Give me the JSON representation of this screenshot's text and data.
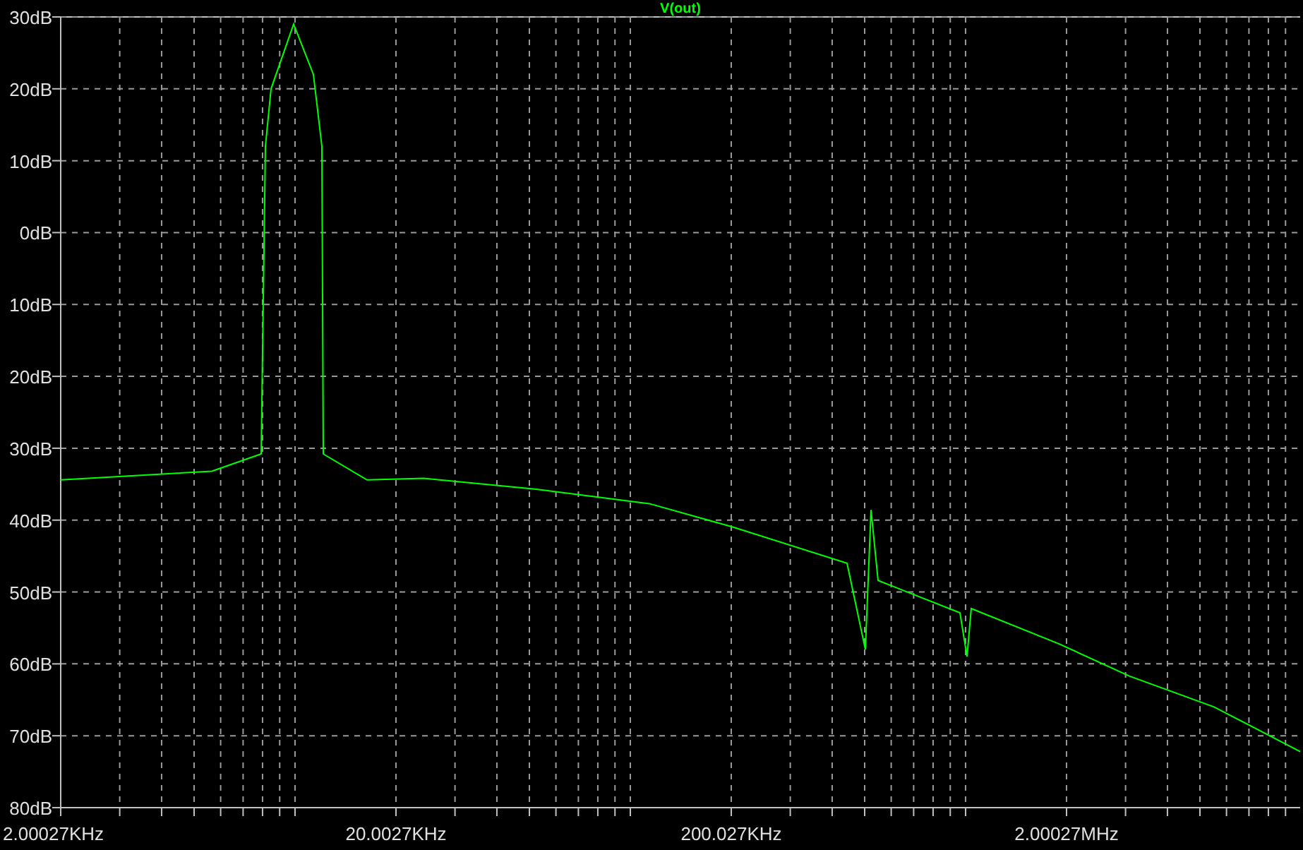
{
  "plot": {
    "title": "V(out)",
    "y_axis_labels": [
      "30dB",
      "20dB",
      "10dB",
      "0dB",
      "10dB",
      "20dB",
      "30dB",
      "40dB",
      "50dB",
      "60dB",
      "70dB",
      "80dB"
    ],
    "x_axis_labels": [
      "2.00027KHz",
      "20.0027KHz",
      "200.027KHz",
      "2.00027MHz"
    ]
  }
}
